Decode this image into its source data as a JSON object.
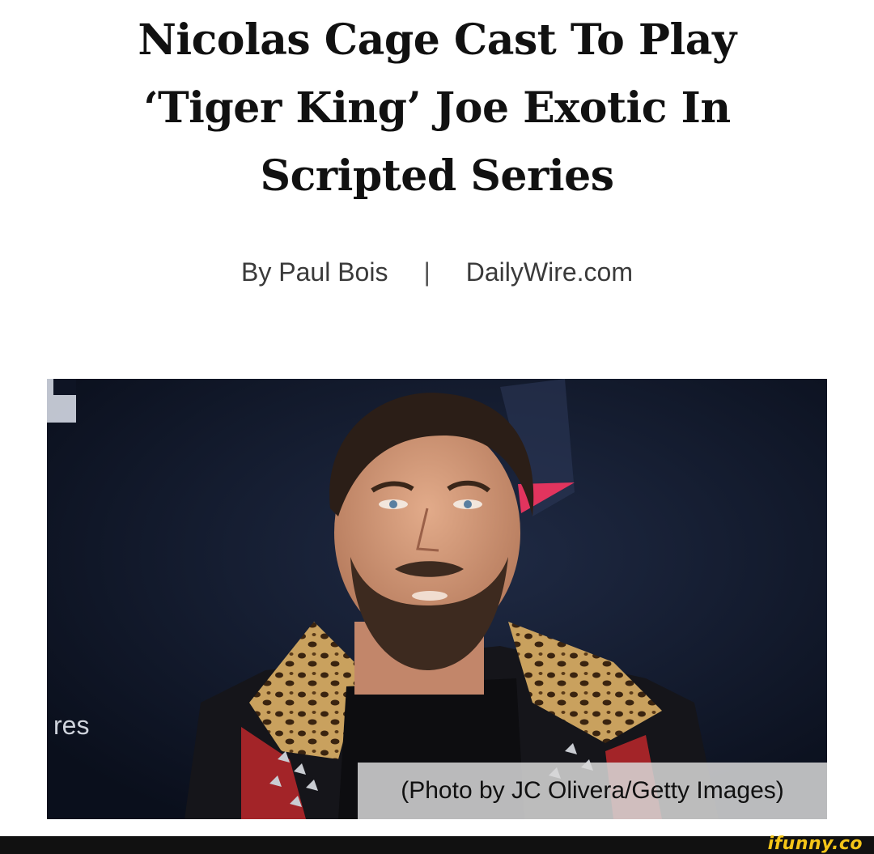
{
  "article": {
    "headline_lines": [
      "Nicolas Cage Cast To Play",
      "‘Tiger King’ Joe Exotic In",
      "Scripted Series"
    ],
    "author": "By Paul Bois",
    "separator": "|",
    "source": "DailyWire.com"
  },
  "photo": {
    "background_text": "res",
    "caption": "(Photo by JC Olivera/Getty Images)"
  },
  "footer": {
    "watermark": "ifunny.co"
  },
  "colors": {
    "photo_background": "#0e1424",
    "caption_background": "#d7d7d7",
    "watermark": "#f4c518",
    "footer_bar": "#111111"
  }
}
